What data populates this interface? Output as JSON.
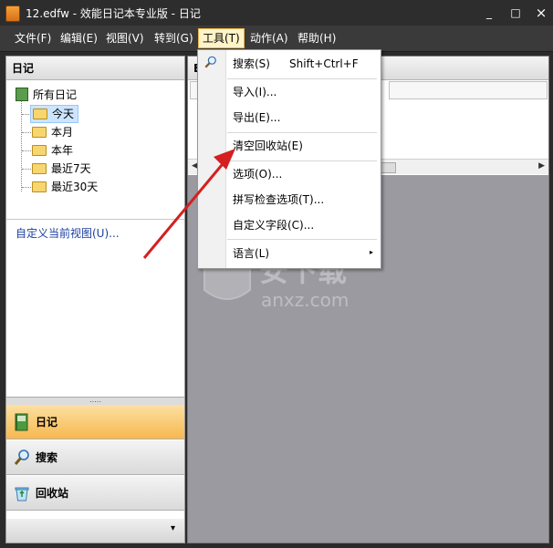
{
  "window": {
    "title": "12.edfw - 效能日记本专业版 - 日记",
    "minimize": "_",
    "maximize": "□",
    "close": "×"
  },
  "menubar": {
    "items": [
      {
        "label": "文件(F)"
      },
      {
        "label": "编辑(E)"
      },
      {
        "label": "视图(V)"
      },
      {
        "label": "转到(G)"
      },
      {
        "label": "工具(T)",
        "active": true
      },
      {
        "label": "动作(A)"
      },
      {
        "label": "帮助(H)"
      }
    ]
  },
  "sidebar": {
    "header": "日记",
    "tree": {
      "root": "所有日记",
      "children": [
        "今天",
        "本月",
        "本年",
        "最近7天",
        "最近30天"
      ],
      "selected": "今天"
    },
    "custom_view_link": "自定义当前视图(U)...",
    "nav": [
      {
        "label": "日记",
        "icon": "diary-book-icon",
        "active": true
      },
      {
        "label": "搜索",
        "icon": "search-icon"
      },
      {
        "label": "回收站",
        "icon": "recycle-bin-icon"
      }
    ],
    "footer_arrow": "▾"
  },
  "right": {
    "header": "E"
  },
  "tools_menu": {
    "items": [
      {
        "label": "搜索(S)",
        "shortcut": "Shift+Ctrl+F"
      },
      {
        "label": "导入(I)..."
      },
      {
        "label": "导出(E)..."
      },
      {
        "label": "清空回收站(E)"
      },
      {
        "label": "选项(O)..."
      },
      {
        "label": "拼写检查选项(T)..."
      },
      {
        "label": "自定义字段(C)..."
      },
      {
        "label": "语言(L)",
        "submenu": "▸"
      }
    ]
  },
  "watermark": {
    "text": "安下载",
    "subtext": "anxz.com"
  },
  "colors": {
    "titlebar": "#2d2d2d",
    "menubar": "#3a3a3a",
    "active_menu": "#fff3c7",
    "nav_active": "#f7b84f",
    "arrow": "#d42020"
  }
}
